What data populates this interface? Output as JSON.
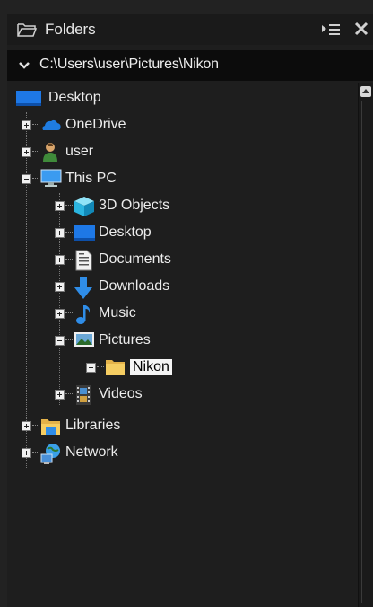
{
  "header": {
    "title": "Folders",
    "sort_icon": "list-sort-icon",
    "close_icon": "close-icon"
  },
  "pathbar": {
    "path": "C:\\Users\\user\\Pictures\\Nikon"
  },
  "tree": {
    "desktop_root": "Desktop",
    "onedrive": "OneDrive",
    "user": "user",
    "this_pc": "This PC",
    "objects3d": "3D Objects",
    "desktop": "Desktop",
    "documents": "Documents",
    "downloads": "Downloads",
    "music": "Music",
    "pictures": "Pictures",
    "nikon": "Nikon",
    "videos": "Videos",
    "libraries": "Libraries",
    "network": "Network"
  },
  "colors": {
    "background": "#222222",
    "selection": "#f4f4f4",
    "desktop_blue": "#1e78e6"
  }
}
